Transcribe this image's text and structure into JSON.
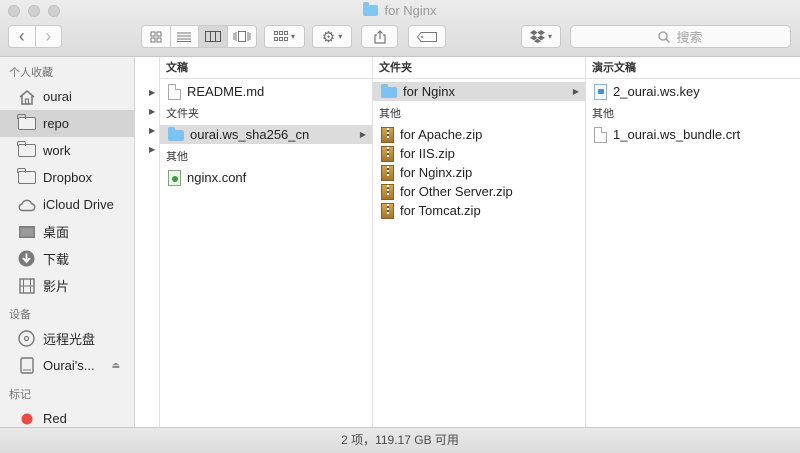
{
  "window": {
    "title": "for Nginx"
  },
  "toolbar": {
    "back_glyph": "‹",
    "forward_glyph": "›",
    "share_icon": "share-icon",
    "search": {
      "placeholder": "搜索"
    }
  },
  "sidebar": {
    "sections": [
      {
        "label": "个人收藏",
        "items": [
          {
            "label": "ourai",
            "icon": "home-icon"
          },
          {
            "label": "repo",
            "icon": "folder-icon",
            "selected": true
          },
          {
            "label": "work",
            "icon": "folder-icon"
          },
          {
            "label": "Dropbox",
            "icon": "folder-icon"
          },
          {
            "label": "iCloud Drive",
            "icon": "cloud-icon"
          },
          {
            "label": "桌面",
            "icon": "desktop-icon"
          },
          {
            "label": "下载",
            "icon": "download-icon"
          },
          {
            "label": "影片",
            "icon": "film-icon"
          }
        ]
      },
      {
        "label": "设备",
        "items": [
          {
            "label": "远程光盘",
            "icon": "disc-icon"
          },
          {
            "label": "Ourai's...",
            "icon": "drive-icon"
          }
        ]
      },
      {
        "label": "标记",
        "items": [
          {
            "label": "Red",
            "icon": "red-tag-icon"
          }
        ]
      }
    ]
  },
  "columns": [
    {
      "header": "文稿",
      "top_items": [
        {
          "name": "README.md",
          "type": "doc"
        }
      ],
      "groups": [
        {
          "label": "文件夹",
          "items": [
            {
              "name": "ourai.ws_sha256_cn",
              "type": "folder",
              "selected": true
            }
          ]
        },
        {
          "label": "其他",
          "items": [
            {
              "name": "nginx.conf",
              "type": "conf"
            }
          ]
        }
      ]
    },
    {
      "header": "文件夹",
      "top_items": [
        {
          "name": "for Nginx",
          "type": "folder",
          "selected": true
        }
      ],
      "groups": [
        {
          "label": "其他",
          "items": [
            {
              "name": "for Apache.zip",
              "type": "zip"
            },
            {
              "name": "for IIS.zip",
              "type": "zip"
            },
            {
              "name": "for Nginx.zip",
              "type": "zip"
            },
            {
              "name": "for Other Server.zip",
              "type": "zip"
            },
            {
              "name": "for Tomcat.zip",
              "type": "zip"
            }
          ]
        }
      ]
    },
    {
      "header": "演示文稿",
      "top_items": [
        {
          "name": "2_ourai.ws.key",
          "type": "key"
        }
      ],
      "groups": [
        {
          "label": "其他",
          "items": [
            {
              "name": "1_ourai.ws_bundle.crt",
              "type": "doc"
            }
          ]
        }
      ]
    }
  ],
  "status": {
    "text": "2 项，119.17 GB 可用"
  },
  "colors": {
    "accent_folder": "#7cc3f2",
    "selected_row": "#dcdcdc",
    "tag_red": "#ef4a42"
  }
}
